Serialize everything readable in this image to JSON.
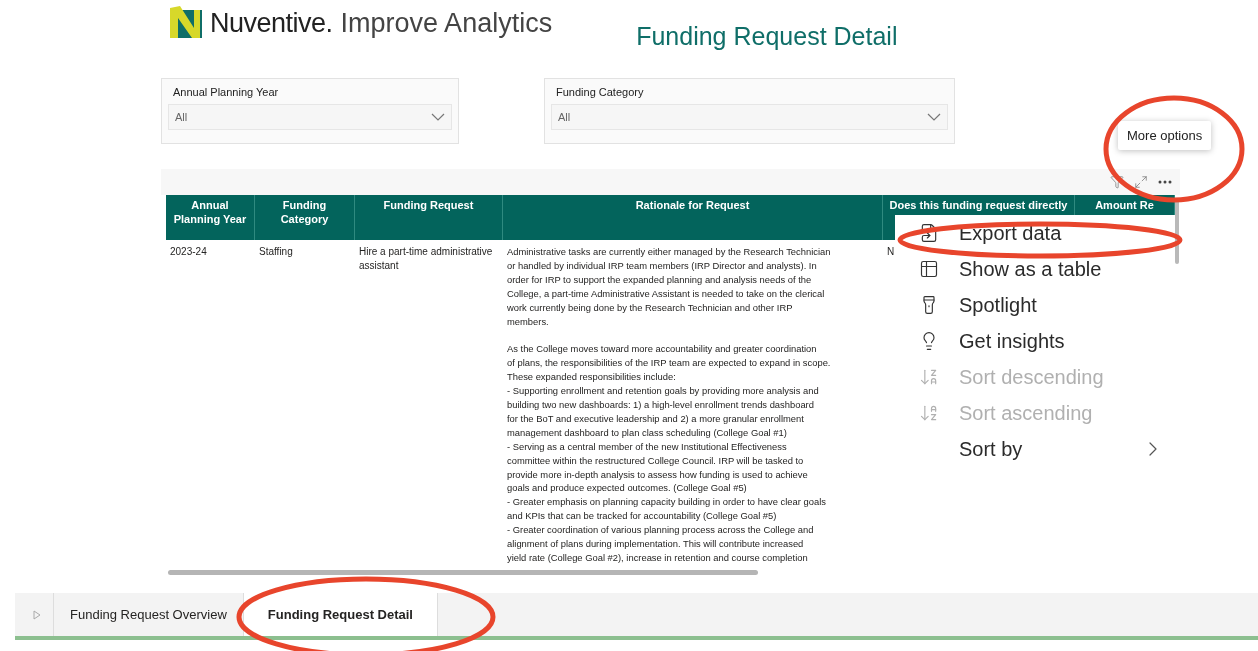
{
  "header": {
    "brand": "Nuventive.",
    "product": "Improve Analytics",
    "page_title": "Funding Request Detail"
  },
  "filters": [
    {
      "label": "Annual Planning Year",
      "value": "All"
    },
    {
      "label": "Funding Category",
      "value": "All"
    }
  ],
  "table": {
    "columns": [
      "Annual Planning Year",
      "Funding Category",
      "Funding Request",
      "Rationale for Request",
      "Does this funding request directly",
      "Amount Re"
    ],
    "rows": [
      {
        "cells": [
          "2023-24",
          "Staffing",
          "Hire a part-time administrative assistant",
          "Administrative tasks are currently either managed by the Research Technician\nor handled by individual IRP team members (IRP Director and analysts). In\norder for IRP to support the expanded planning and analysis needs of the\nCollege, a part-time Administrative Assistant is needed to take on the clerical\nwork currently being done by the Research Technician and other IRP\nmembers.\n\nAs the College moves toward more accountability and greater coordination\nof plans, the responsibilities of the IRP team are expected to expand in scope.\nThese expanded responsibilities include:\n- Supporting enrollment and retention goals by providing more analysis and\nbuilding two new dashboards: 1) a high-level enrollment trends dashboard\nfor the BoT and executive leadership and 2) a more granular enrollment\nmanagement dashboard to plan class scheduling (College Goal #1)\n- Serving as a central member of the new Institutional Effectiveness\ncommittee within the restructured College Council. IRP will be tasked to\nprovide more in-depth analysis to assess how funding is used to achieve\ngoals and produce expected outcomes. (College Goal #5)\n- Greater emphasis on planning capacity building in order to have clear goals\nand KPIs that can be tracked for accountability (College Goal #5)\n- Greater coordination of various planning process across the College and\nalignment of plans during implementation. This will contribute increased\nyield rate (College Goal #2), increase in retention and course completion",
          "N"
        ]
      }
    ]
  },
  "tooltip": "More options",
  "context_menu": [
    {
      "label": "Export data",
      "disabled": false,
      "submenu": false
    },
    {
      "label": "Show as a table",
      "disabled": false,
      "submenu": false
    },
    {
      "label": "Spotlight",
      "disabled": false,
      "submenu": false
    },
    {
      "label": "Get insights",
      "disabled": false,
      "submenu": false
    },
    {
      "label": "Sort descending",
      "disabled": true,
      "submenu": false
    },
    {
      "label": "Sort ascending",
      "disabled": true,
      "submenu": false
    },
    {
      "label": "Sort by",
      "disabled": false,
      "submenu": true
    }
  ],
  "page_tabs": [
    {
      "label": "Funding Request Overview",
      "selected": false
    },
    {
      "label": "Funding Request Detail",
      "selected": true
    }
  ]
}
